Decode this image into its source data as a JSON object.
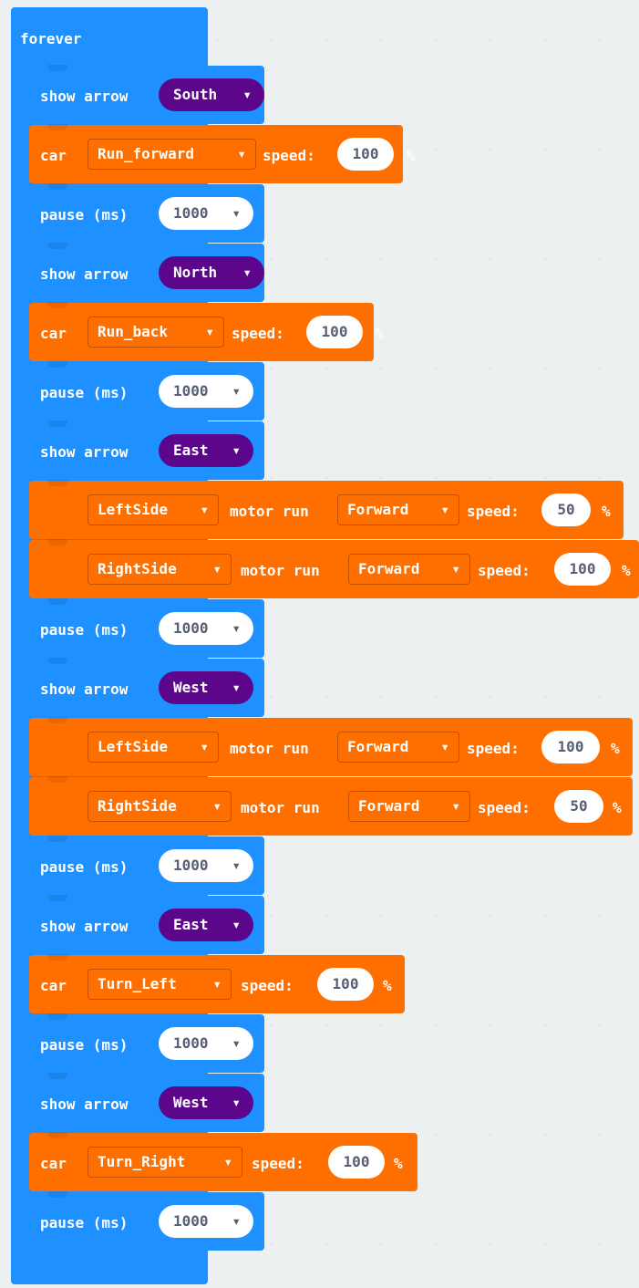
{
  "forever": {
    "label": "forever"
  },
  "blocks": {
    "b0": {
      "label": "show arrow",
      "value": "South"
    },
    "b1": {
      "label": "car",
      "value": "Run_forward",
      "speed_label": "speed:",
      "speed": "100",
      "unit": "%"
    },
    "b2": {
      "label": "pause (ms)",
      "value": "1000"
    },
    "b3": {
      "label": "show arrow",
      "value": "North"
    },
    "b4": {
      "label": "car",
      "value": "Run_back",
      "speed_label": "speed:",
      "speed": "100",
      "unit": "%"
    },
    "b5": {
      "label": "pause (ms)",
      "value": "1000"
    },
    "b6": {
      "label": "show arrow",
      "value": "East"
    },
    "b7": {
      "side": "LeftSide",
      "label": "motor run",
      "value": "Forward",
      "speed_label": "speed:",
      "speed": "50",
      "unit": "%"
    },
    "b8": {
      "side": "RightSide",
      "label": "motor run",
      "value": "Forward",
      "speed_label": "speed:",
      "speed": "100",
      "unit": "%"
    },
    "b9": {
      "label": "pause (ms)",
      "value": "1000"
    },
    "b10": {
      "label": "show arrow",
      "value": "West"
    },
    "b11": {
      "side": "LeftSide",
      "label": "motor run",
      "value": "Forward",
      "speed_label": "speed:",
      "speed": "100",
      "unit": "%"
    },
    "b12": {
      "side": "RightSide",
      "label": "motor run",
      "value": "Forward",
      "speed_label": "speed:",
      "speed": "50",
      "unit": "%"
    },
    "b13": {
      "label": "pause (ms)",
      "value": "1000"
    },
    "b14": {
      "label": "show arrow",
      "value": "East"
    },
    "b15": {
      "label": "car",
      "value": "Turn_Left",
      "speed_label": "speed:",
      "speed": "100",
      "unit": "%"
    },
    "b16": {
      "label": "pause (ms)",
      "value": "1000"
    },
    "b17": {
      "label": "show arrow",
      "value": "West"
    },
    "b18": {
      "label": "car",
      "value": "Turn_Right",
      "speed_label": "speed:",
      "speed": "100",
      "unit": "%"
    },
    "b19": {
      "label": "pause (ms)",
      "value": "1000"
    }
  },
  "icons": {
    "dropdown": "caret-down-icon"
  },
  "colors": {
    "basic_blue": "#1e90ff",
    "motor_orange": "#ff6f00",
    "arrow_purple": "#5c068c",
    "workspace": "#ecf0f1"
  }
}
